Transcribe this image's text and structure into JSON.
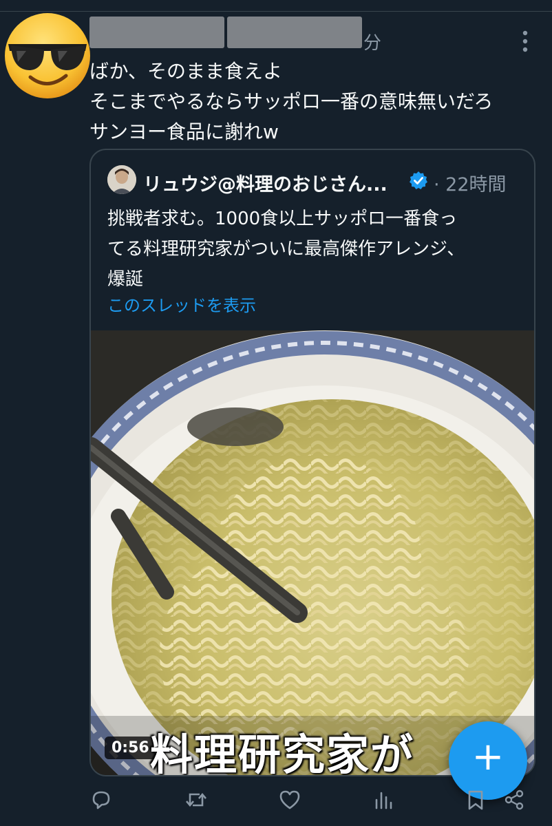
{
  "tweet": {
    "time_suffix": "分",
    "lines": [
      "ばか、そのまま食えよ",
      "そこまでやるならサッポロ一番の意味無いだろ",
      "サンヨー食品に謝れw"
    ]
  },
  "quote": {
    "author_name": "リュウジ@料理のおじさん...",
    "time": "· 22時間",
    "text_lines": [
      "挑戦者求む。1000食以上サッポロ一番食っ",
      "てる料理研究家がついに最高傑作アレンジ、",
      "爆誕"
    ],
    "thread_link": "このスレッドを表示",
    "video": {
      "duration": "0:56",
      "caption": "料理研究家が"
    }
  },
  "fab": {
    "label": "+"
  },
  "icons": {
    "avatar": "sunglasses-emoji-icon",
    "more": "vertical-ellipsis-icon",
    "verified": "verified-badge-icon",
    "reply": "reply-icon",
    "retweet": "retweet-icon",
    "like": "heart-icon",
    "views": "views-chart-icon",
    "bookmark": "bookmark-icon",
    "share": "share-icon"
  },
  "colors": {
    "background": "#15202b",
    "accent": "#1d9bf0",
    "secondary_text": "#8b98a5",
    "border": "#38444d"
  }
}
